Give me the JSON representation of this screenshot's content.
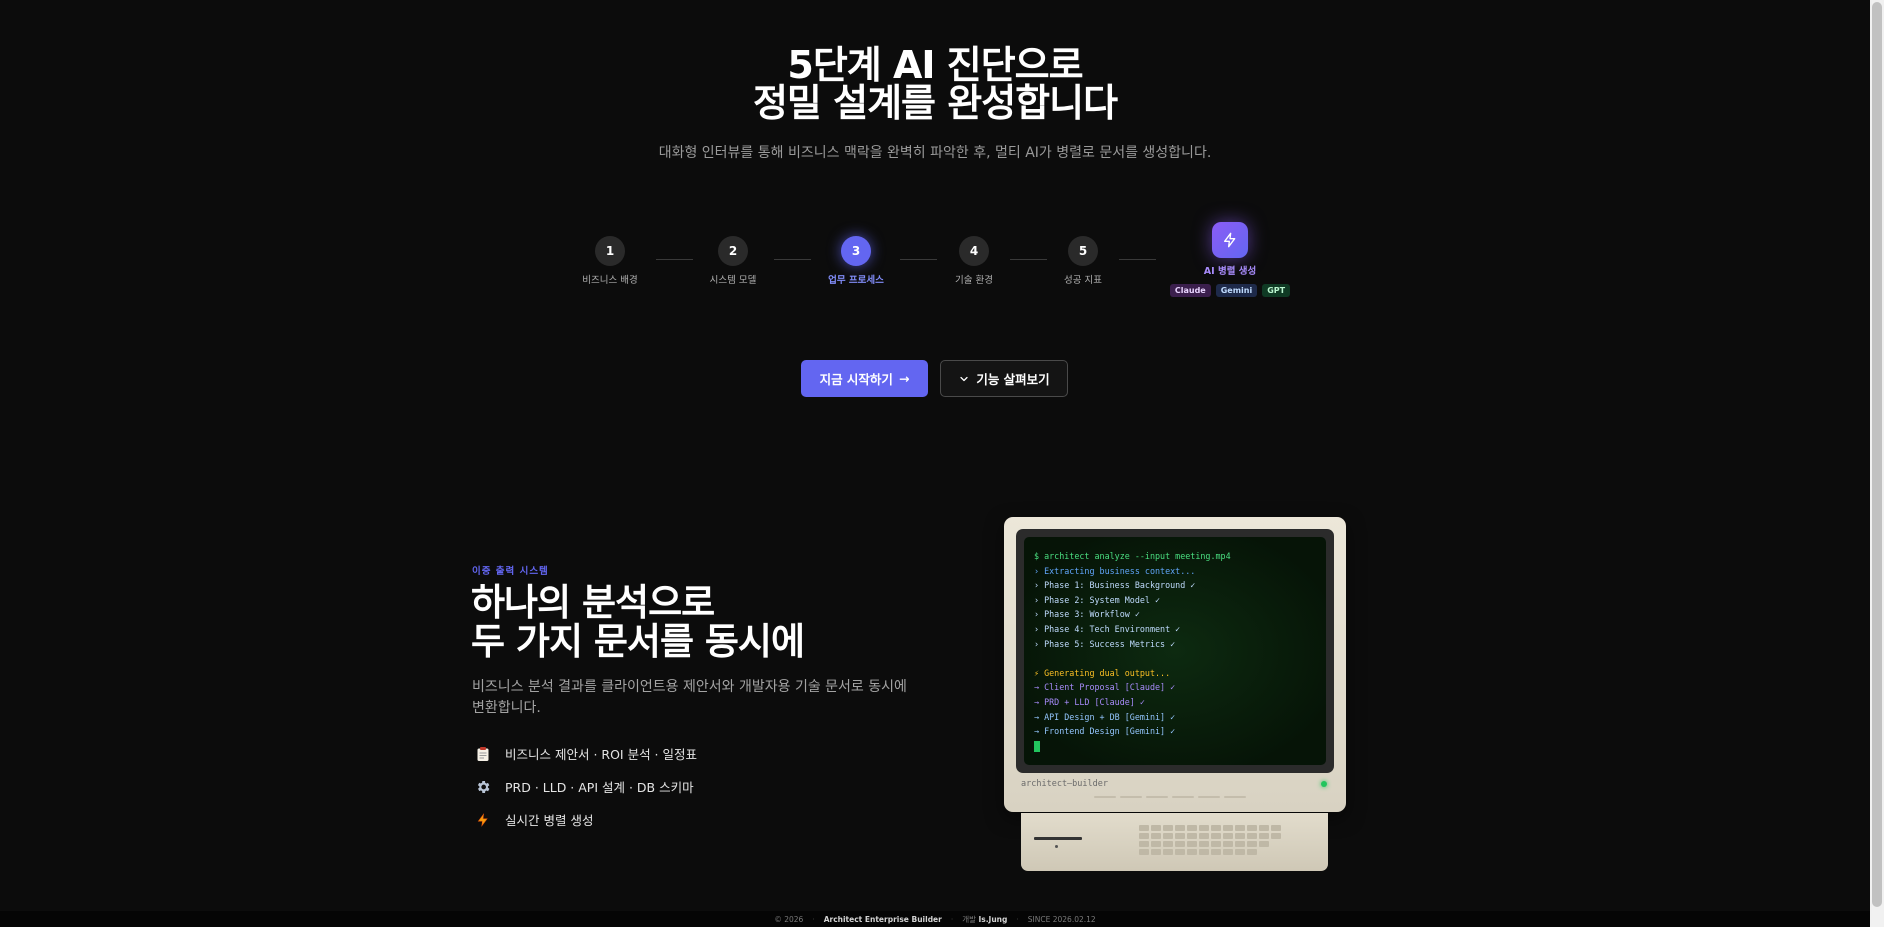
{
  "hero": {
    "title_line1": "5단계 AI 진단으로",
    "title_line2": "정밀 설계를 완성합니다",
    "subtitle": "대화형 인터뷰를 통해 비즈니스 맥락을 완벽히 파악한 후, 멀티 AI가 병렬로 문서를 생성합니다."
  },
  "steps": [
    {
      "number": "1",
      "label": "비즈니스 배경",
      "active": false
    },
    {
      "number": "2",
      "label": "시스템 모델",
      "active": false
    },
    {
      "number": "3",
      "label": "업무 프로세스",
      "active": true
    },
    {
      "number": "4",
      "label": "기술 환경",
      "active": false
    },
    {
      "number": "5",
      "label": "성공 지표",
      "active": false
    }
  ],
  "ai_step": {
    "icon": "lightning-icon",
    "label": "AI 병렬 생성",
    "tags": [
      "Claude",
      "Gemini",
      "GPT"
    ]
  },
  "buttons": {
    "start_label": "지금 시작하기",
    "start_arrow": "→",
    "features_label": "기능 살펴보기",
    "features_icon": "chevron-down-icon"
  },
  "dual_output": {
    "eyebrow": "이중 출력 시스템",
    "title_line1": "하나의 분석으로",
    "title_line2": "두 가지 문서를 동시에",
    "description": "비즈니스 분석 결과를 클라이언트용 제안서와 개발자용 기술 문서로 동시에 변환합니다.",
    "features": [
      {
        "icon": "clipboard-icon",
        "text": "비즈니스 제안서 · ROI 분석 · 일정표"
      },
      {
        "icon": "gear-icon",
        "text": "PRD · LLD · API 설계 · DB 스키마"
      },
      {
        "icon": "lightning-icon",
        "text": "실시간 병렬 생성"
      }
    ]
  },
  "terminal": {
    "lines": [
      {
        "text": "$ architect analyze --input meeting.mp4",
        "color": "#4ade80"
      },
      {
        "text": "› Extracting business context...",
        "color": "#60a5fa"
      },
      {
        "text": "› Phase 1: Business Background ✓",
        "color": "#bfdbfe"
      },
      {
        "text": "› Phase 2: System Model ✓",
        "color": "#bfdbfe"
      },
      {
        "text": "› Phase 3: Workflow ✓",
        "color": "#bfdbfe"
      },
      {
        "text": "› Phase 4: Tech Environment ✓",
        "color": "#bfdbfe"
      },
      {
        "text": "› Phase 5: Success Metrics ✓",
        "color": "#bfdbfe"
      },
      {
        "text": "",
        "color": "#bfdbfe"
      },
      {
        "text": "⚡ Generating dual output...",
        "color": "#fbbf24"
      },
      {
        "text": "→ Client Proposal [Claude] ✓",
        "color": "#a78bfa"
      },
      {
        "text": "→ PRD + LLD [Claude] ✓",
        "color": "#a78bfa"
      },
      {
        "text": "→ API Design + DB [Gemini] ✓",
        "color": "#93c5fd"
      },
      {
        "text": "→ Frontend Design [Gemini] ✓",
        "color": "#93c5fd"
      }
    ],
    "brand": "architect—builder"
  },
  "footer": {
    "copyright": "© 2026",
    "product": "Architect Enterprise Builder",
    "dev_prefix": "개발",
    "developer": "Is.Jung",
    "since": "SINCE 2026.02.12"
  },
  "colors": {
    "accent": "#6366f1",
    "accent_violet": "#8b5cf6",
    "background": "#0c0c0c",
    "terminal_green": "#22c55e"
  }
}
